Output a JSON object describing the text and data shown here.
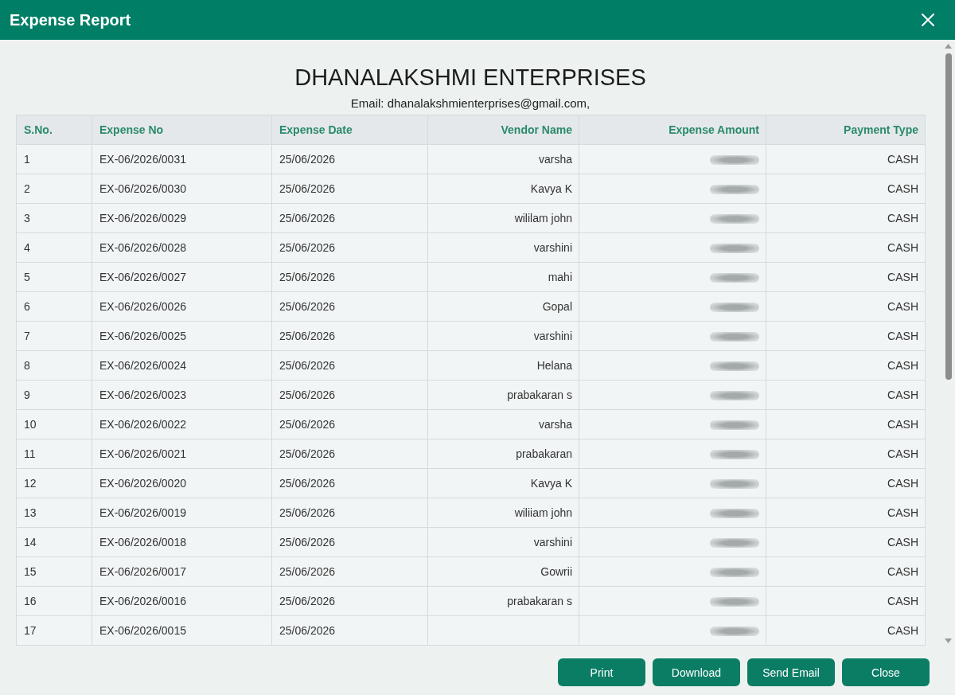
{
  "window": {
    "title": "Expense Report"
  },
  "report": {
    "company": "DHANALAKSHMI ENTERPRISES",
    "email_line": "Email: dhanalakshmienterprises@gmail.com,"
  },
  "table": {
    "columns": [
      "S.No.",
      "Expense No",
      "Expense Date",
      "Vendor Name",
      "Expense Amount",
      "Payment Type"
    ],
    "rows": [
      {
        "sno": "1",
        "expense_no": "EX-06/2026/0031",
        "date": "25/06/2026",
        "vendor": "varsha",
        "amount_hidden": true,
        "payment_type": "CASH"
      },
      {
        "sno": "2",
        "expense_no": "EX-06/2026/0030",
        "date": "25/06/2026",
        "vendor": "Kavya K",
        "amount_hidden": true,
        "payment_type": "CASH"
      },
      {
        "sno": "3",
        "expense_no": "EX-06/2026/0029",
        "date": "25/06/2026",
        "vendor": "wililam john",
        "amount_hidden": true,
        "payment_type": "CASH"
      },
      {
        "sno": "4",
        "expense_no": "EX-06/2026/0028",
        "date": "25/06/2026",
        "vendor": "varshini",
        "amount_hidden": true,
        "payment_type": "CASH"
      },
      {
        "sno": "5",
        "expense_no": "EX-06/2026/0027",
        "date": "25/06/2026",
        "vendor": "mahi",
        "amount_hidden": true,
        "payment_type": "CASH"
      },
      {
        "sno": "6",
        "expense_no": "EX-06/2026/0026",
        "date": "25/06/2026",
        "vendor": "Gopal",
        "amount_hidden": true,
        "payment_type": "CASH"
      },
      {
        "sno": "7",
        "expense_no": "EX-06/2026/0025",
        "date": "25/06/2026",
        "vendor": "varshini",
        "amount_hidden": true,
        "payment_type": "CASH"
      },
      {
        "sno": "8",
        "expense_no": "EX-06/2026/0024",
        "date": "25/06/2026",
        "vendor": "Helana",
        "amount_hidden": true,
        "payment_type": "CASH"
      },
      {
        "sno": "9",
        "expense_no": "EX-06/2026/0023",
        "date": "25/06/2026",
        "vendor": "prabakaran s",
        "amount_hidden": true,
        "payment_type": "CASH"
      },
      {
        "sno": "10",
        "expense_no": "EX-06/2026/0022",
        "date": "25/06/2026",
        "vendor": "varsha",
        "amount_hidden": true,
        "payment_type": "CASH"
      },
      {
        "sno": "11",
        "expense_no": "EX-06/2026/0021",
        "date": "25/06/2026",
        "vendor": "prabakaran",
        "amount_hidden": true,
        "payment_type": "CASH"
      },
      {
        "sno": "12",
        "expense_no": "EX-06/2026/0020",
        "date": "25/06/2026",
        "vendor": "Kavya K",
        "amount_hidden": true,
        "payment_type": "CASH"
      },
      {
        "sno": "13",
        "expense_no": "EX-06/2026/0019",
        "date": "25/06/2026",
        "vendor": "wiliiam john",
        "amount_hidden": true,
        "payment_type": "CASH"
      },
      {
        "sno": "14",
        "expense_no": "EX-06/2026/0018",
        "date": "25/06/2026",
        "vendor": "varshini",
        "amount_hidden": true,
        "payment_type": "CASH"
      },
      {
        "sno": "15",
        "expense_no": "EX-06/2026/0017",
        "date": "25/06/2026",
        "vendor": "Gowrii",
        "amount_hidden": true,
        "payment_type": "CASH"
      },
      {
        "sno": "16",
        "expense_no": "EX-06/2026/0016",
        "date": "25/06/2026",
        "vendor": "prabakaran s",
        "amount_hidden": true,
        "payment_type": "CASH"
      },
      {
        "sno": "17",
        "expense_no": "EX-06/2026/0015",
        "date": "25/06/2026",
        "amount_hidden": true,
        "payment_type": "CASH"
      }
    ]
  },
  "buttons": [
    "Print",
    "Download",
    "Send Email",
    "Close"
  ]
}
